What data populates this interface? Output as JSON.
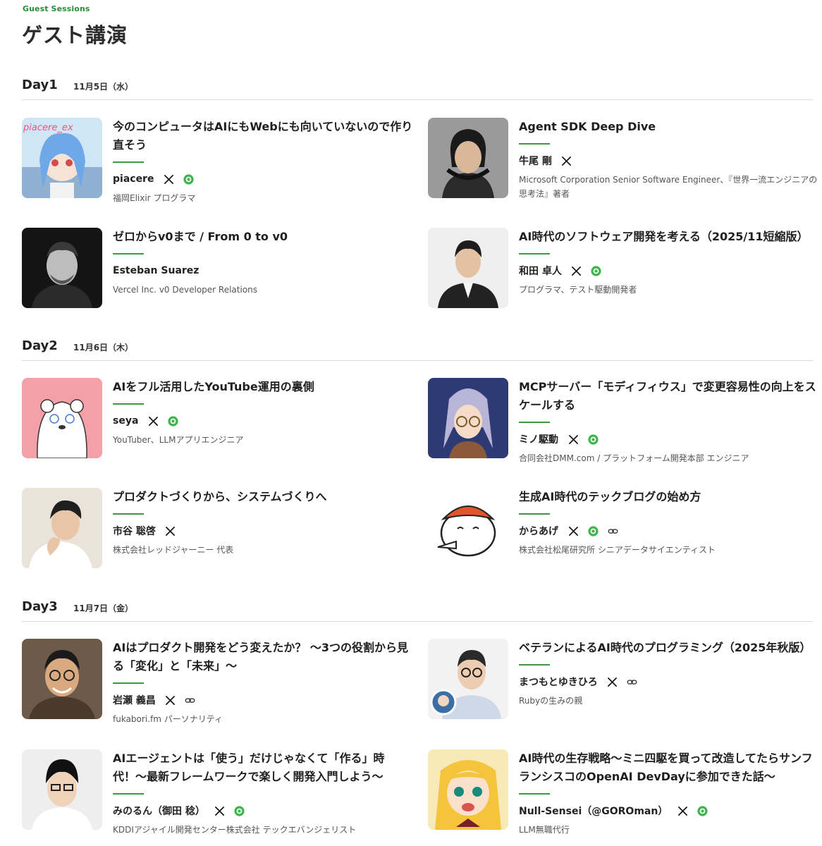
{
  "header": {
    "eyebrow": "Guest Sessions",
    "title": "ゲスト講演"
  },
  "days": [
    {
      "label": "Day1",
      "date": "11月5日（水）"
    },
    {
      "label": "Day2",
      "date": "11月6日（木）"
    },
    {
      "label": "Day3",
      "date": "11月7日（金）"
    }
  ],
  "sessions": [
    {
      "title": "今のコンピュータはAIにもWebにも向いていないので作り直そう",
      "speaker": "piacere",
      "affiliation": "福岡Elixir プログラマ",
      "photo_text": "piacere_ex",
      "links": [
        "x-icon",
        "web-icon"
      ]
    },
    {
      "title": "Agent SDK Deep Dive",
      "speaker": "牛尾 剛",
      "affiliation": "Microsoft Corporation Senior Software Engineer、『世界一流エンジニアの思考法』著者",
      "links": [
        "x-icon"
      ]
    },
    {
      "title": "ゼロからv0まで / From 0 to v0",
      "speaker": "Esteban Suarez",
      "affiliation": "Vercel Inc. v0 Developer Relations",
      "links": []
    },
    {
      "title": "AI時代のソフトウェア開発を考える（2025/11短縮版）",
      "speaker": "和田 卓人",
      "affiliation": "プログラマ、テスト駆動開発者",
      "links": [
        "x-icon",
        "web-icon"
      ]
    },
    {
      "title": "AIをフル活用したYouTube運用の裏側",
      "speaker": "seya",
      "affiliation": "YouTuber、LLMアプリエンジニア",
      "links": [
        "x-icon",
        "web-icon"
      ]
    },
    {
      "title": "MCPサーバー「モディフィウス」で変更容易性の向上をスケールする",
      "speaker": "ミノ駆動",
      "affiliation": "合同会社DMM.com / プラットフォーム開発本部 エンジニア",
      "links": [
        "x-icon",
        "web-icon"
      ]
    },
    {
      "title": "プロダクトづくりから、システムづくりへ",
      "speaker": "市谷 聡啓",
      "affiliation": "株式会社レッドジャーニー 代表",
      "links": [
        "x-icon"
      ]
    },
    {
      "title": "生成AI時代のテックブログの始め方",
      "speaker": "からあげ",
      "affiliation": "株式会社松尾研究所 シニアデータサイエンティスト",
      "links": [
        "x-icon",
        "web-icon",
        "link-icon"
      ]
    },
    {
      "title": "AIはプロダクト開発をどう変えたか？ 〜3つの役割から見る「変化」と「未来」〜",
      "speaker": "岩瀬 義昌",
      "affiliation": "fukabori.fm パーソナリティ",
      "links": [
        "x-icon",
        "link-icon"
      ]
    },
    {
      "title": "ベテランによるAI時代のプログラミング（2025年秋版）",
      "speaker": "まつもとゆきひろ",
      "affiliation": "Rubyの生みの親",
      "links": [
        "x-icon",
        "link-icon"
      ]
    },
    {
      "title": "AIエージェントは「使う」だけじゃなくて「作る」時代！〜最新フレームワークで楽しく開発入門しよう〜",
      "speaker": "みのるん（御田 稔）",
      "affiliation": "KDDIアジャイル開発センター株式会社 テックエバンジェリスト",
      "links": [
        "x-icon",
        "web-icon"
      ]
    },
    {
      "title": "AI時代の生存戦略〜ミニ四駆を買って改造してたらサンフランシスコのOpenAI DevDayに参加できた話〜",
      "speaker": "Null-Sensei（@GOROman）",
      "affiliation": "LLM無職代行",
      "links": [
        "x-icon",
        "web-icon"
      ]
    }
  ],
  "colors": {
    "accent": "#3f9a3f",
    "eyebrow": "#2f8a3a",
    "divider": "#dcdcdc",
    "web_icon": "#3cb54a"
  }
}
